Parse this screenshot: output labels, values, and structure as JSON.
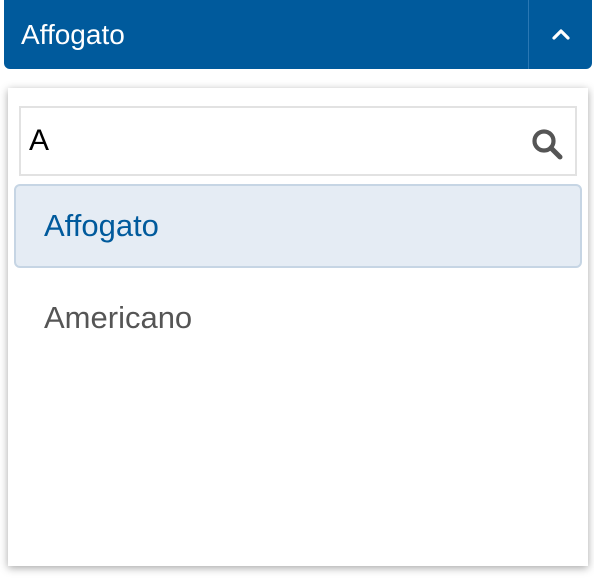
{
  "combobox": {
    "selected_value": "Affogato",
    "toggle_icon": "chevron-up-icon",
    "colors": {
      "background": "#005a9c",
      "text": "#ffffff"
    }
  },
  "search": {
    "value": "A",
    "icon": "search-icon"
  },
  "options": [
    {
      "label": "Affogato",
      "selected": true
    },
    {
      "label": "Americano",
      "selected": false
    }
  ],
  "colors": {
    "selected_background": "#e5ecf4",
    "selected_text": "#005a9c",
    "option_text": "#555555"
  }
}
